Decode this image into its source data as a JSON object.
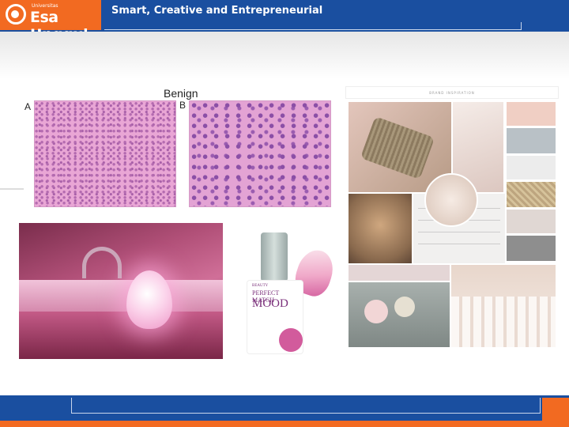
{
  "header": {
    "logo_small": "Universitas",
    "logo_name": "Esa Unggul",
    "tagline": "Smart, Creative and Entrepreneurial"
  },
  "slide": {
    "histology": {
      "title": "Benign",
      "label_a": "A",
      "label_b": "B"
    },
    "polish_label": {
      "brand": "BEAUTY",
      "line1": "PERFECT MATCH",
      "line2": "MOOD"
    },
    "moodboard": {
      "header": "BRAND INSPIRATION"
    }
  },
  "colors": {
    "brand_blue": "#1a4fa0",
    "brand_orange": "#f26a21"
  }
}
